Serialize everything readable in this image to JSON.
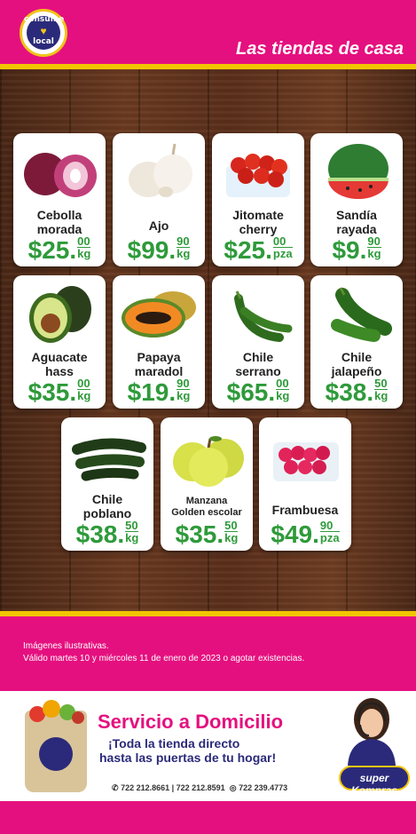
{
  "header": {
    "logo_text_top": "consume",
    "logo_text_bottom": "local",
    "tagline": "Las tiendas de casa"
  },
  "colors": {
    "brand_pink": "#e5107f",
    "accent_yellow": "#f2c500",
    "price_green": "#2e9a3a",
    "navy": "#2b2a7a"
  },
  "products": [
    {
      "name_line1": "Cebolla",
      "name_line2": "morada",
      "whole": "25.",
      "cents": "00",
      "unit": "kg",
      "icon": "red-onion-icon"
    },
    {
      "name_line1": "Ajo",
      "name_line2": "",
      "whole": "99.",
      "cents": "90",
      "unit": "kg",
      "icon": "garlic-icon"
    },
    {
      "name_line1": "Jitomate",
      "name_line2": "cherry",
      "whole": "25.",
      "cents": "00",
      "unit": "pza",
      "icon": "cherry-tomato-icon"
    },
    {
      "name_line1": "Sandía",
      "name_line2": "rayada",
      "whole": "9.",
      "cents": "90",
      "unit": "kg",
      "icon": "watermelon-icon"
    },
    {
      "name_line1": "Aguacate",
      "name_line2": "hass",
      "whole": "35.",
      "cents": "00",
      "unit": "kg",
      "icon": "avocado-icon"
    },
    {
      "name_line1": "Papaya",
      "name_line2": "maradol",
      "whole": "19.",
      "cents": "90",
      "unit": "kg",
      "icon": "papaya-icon"
    },
    {
      "name_line1": "Chile",
      "name_line2": "serrano",
      "whole": "65.",
      "cents": "00",
      "unit": "kg",
      "icon": "serrano-pepper-icon"
    },
    {
      "name_line1": "Chile",
      "name_line2": "jalapeño",
      "whole": "38.",
      "cents": "50",
      "unit": "kg",
      "icon": "jalapeno-icon"
    },
    {
      "name_line1": "Chile",
      "name_line2": "poblano",
      "whole": "38.",
      "cents": "50",
      "unit": "kg",
      "icon": "poblano-icon"
    },
    {
      "name_line1": "Manzana",
      "name_line2": "Golden escolar",
      "whole": "35.",
      "cents": "50",
      "unit": "kg",
      "icon": "apple-icon"
    },
    {
      "name_line1": "Frambuesa",
      "name_line2": "",
      "whole": "49.",
      "cents": "90",
      "unit": "pza",
      "icon": "raspberry-icon"
    }
  ],
  "currency_symbol": "$",
  "notes": {
    "line1": "Imágenes ilustrativas.",
    "line2": "Válido martes 10 y miércoles 11 de enero de 2023 o agotar existencias."
  },
  "delivery": {
    "title": "Servicio a Domicilio",
    "subtitle_line1": "¡Toda la tienda directo",
    "subtitle_line2": "hasta las puertas de tu hogar!",
    "phones": "722 212.8661 | 722 212.8591",
    "whatsapp": "722 239.4773",
    "brand_top": "super",
    "brand_name": "Kompras"
  }
}
